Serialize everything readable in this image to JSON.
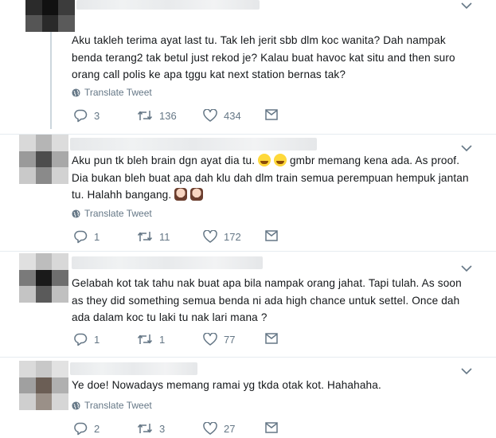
{
  "tweets": [
    {
      "text": "Aku takleh terima ayat last tu. Tak leh jerit sbb dlm koc wanita? Dah nampak benda terang2 tak betul just rekod je? Kalau buat havoc kat situ and then suro orang call polis ke apa tggu kat next station bernas tak?",
      "translate": "Translate Tweet",
      "replies": "3",
      "retweets": "136",
      "likes": "434"
    },
    {
      "text_parts": [
        "Aku pun tk bleh brain dgn ayat dia tu. ",
        " gmbr memang kena ada. As proof. Dia bukan bleh buat apa dah klu dah dlm train semua perempuan hempuk jantan tu. Halahh bangang. "
      ],
      "translate": "Translate Tweet",
      "replies": "1",
      "retweets": "11",
      "likes": "172"
    },
    {
      "text": "Gelabah kot tak tahu nak buat apa bila nampak orang jahat. Tapi tulah. As soon as they did something semua benda ni ada high chance untuk settel. Once dah ada dalam koc tu laki tu nak lari mana ?",
      "translate": "Translate Tweet",
      "replies": "1",
      "retweets": "1",
      "likes": "77"
    },
    {
      "text": "Ye doe! Nowadays memang ramai yg tkda otak kot. Hahahaha.",
      "translate": "Translate Tweet",
      "replies": "2",
      "retweets": "3",
      "likes": "27"
    }
  ],
  "icons": {
    "reply": "reply-icon",
    "retweet": "retweet-icon",
    "like": "heart-icon",
    "dm": "envelope-icon",
    "globe": "globe-icon",
    "caret": "chevron-down-icon"
  },
  "colors": {
    "text": "#14171a",
    "muted": "#657786",
    "divider": "#e6ecf0",
    "thread": "#ccd6dd"
  }
}
